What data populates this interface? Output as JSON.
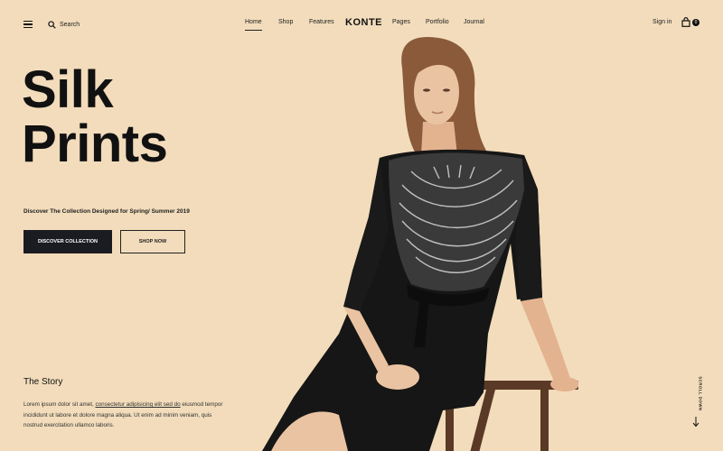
{
  "header": {
    "search_label": "Search",
    "nav": [
      {
        "label": "Home",
        "active": true
      },
      {
        "label": "Shop",
        "active": false
      },
      {
        "label": "Features",
        "active": false
      },
      {
        "label": "Pages",
        "active": false
      },
      {
        "label": "Portfolio",
        "active": false
      },
      {
        "label": "Journal",
        "active": false
      }
    ],
    "logo": "KONTE",
    "signin": "Sign in",
    "cart_count": "0"
  },
  "hero": {
    "title_line1": "Silk",
    "title_line2": "Prints",
    "subtitle": "Discover The Collection Designed for Spring/ Summer 2019",
    "primary_button": "DISCOVER COLLECTION",
    "secondary_button": "SHOP NOW"
  },
  "story": {
    "title": "The Story",
    "text_before": "Lorem ipsum dolor sit amet, ",
    "text_link": "consectetur adipisicing elit sed do",
    "text_after": " eiusmod tempor incididunt ut labore et dolore magna aliqua. Ut enim ad minim veniam, quis nostrud exercitation ullamco laboris."
  },
  "scroll_label": "SCROLL DOWN",
  "colors": {
    "background": "#f2dcbb",
    "dark": "#1b1b22",
    "dress": "#161616",
    "hair": "#8a5a3a",
    "skin": "#e9bf9c",
    "chair": "#5a3a26"
  },
  "icons": {
    "menu": "menu-icon",
    "search": "search-icon",
    "cart": "shopping-bag-icon",
    "scroll": "arrow-down-icon"
  }
}
